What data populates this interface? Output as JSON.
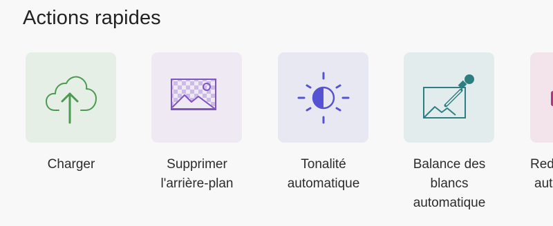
{
  "section": {
    "title": "Actions rapides"
  },
  "actions": [
    {
      "lines": [
        "Charger"
      ],
      "icon": "cloud-upload-icon",
      "tile_color": "#e6efe6",
      "icon_color": "#4a9a52"
    },
    {
      "lines": [
        "Supprimer",
        "l'arrière-plan"
      ],
      "icon": "remove-background-icon",
      "tile_color": "#efe9f3",
      "icon_color": "#7f55c2"
    },
    {
      "lines": [
        "Tonalité",
        "automatique"
      ],
      "icon": "auto-tone-icon",
      "tile_color": "#e8e8f3",
      "icon_color": "#5552d3"
    },
    {
      "lines": [
        "Balance des",
        "blancs",
        "automatique"
      ],
      "icon": "white-balance-icon",
      "tile_color": "#e3ecec",
      "icon_color": "#2e7d80"
    },
    {
      "lines": [
        "Red",
        "aut"
      ],
      "icon": "partial-action-icon",
      "tile_color": "#f3e4ec",
      "icon_color": "#b2337f"
    }
  ]
}
